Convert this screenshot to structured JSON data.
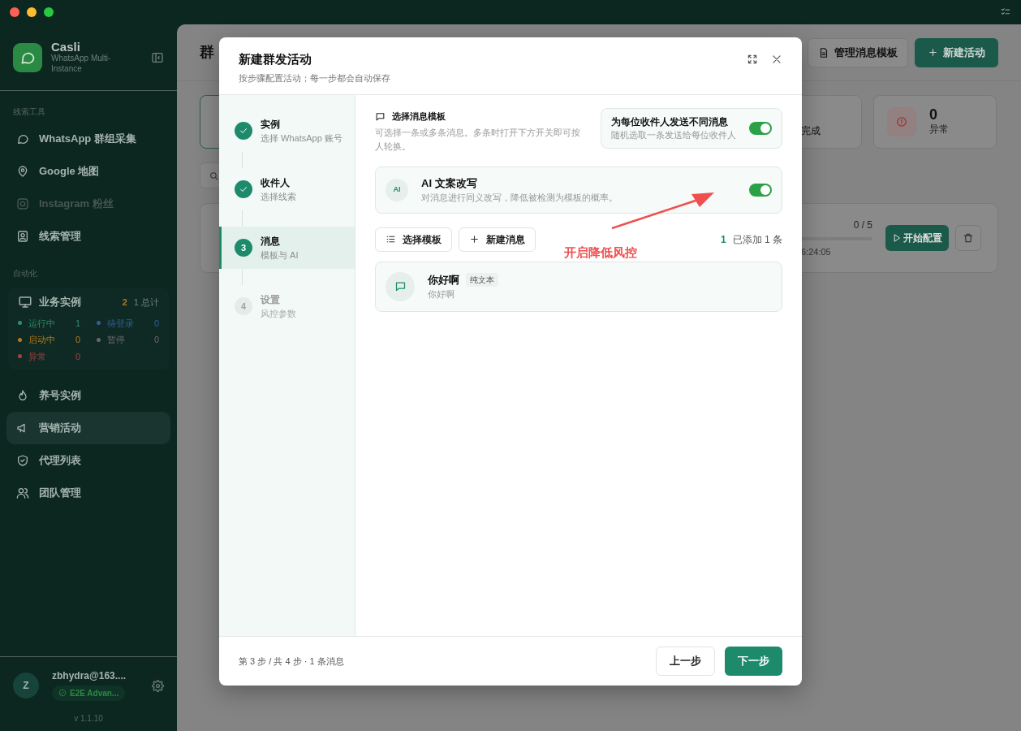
{
  "sidebar": {
    "app_name": "Casli",
    "app_subtitle": "WhatsApp Multi-Instance",
    "sections": [
      {
        "heading": "线索工具",
        "items": [
          {
            "label": "WhatsApp 群组采集",
            "disabled": false,
            "selected": false
          },
          {
            "label": "Google 地图",
            "disabled": false,
            "selected": false
          },
          {
            "label": "Instagram 粉丝",
            "disabled": true,
            "selected": false
          },
          {
            "label": "线索管理",
            "disabled": false,
            "selected": false
          }
        ]
      },
      {
        "heading": "自动化",
        "instances": {
          "title": "业务实例",
          "badge": "2",
          "total": "1 总计",
          "stats": [
            {
              "label": "运行中",
              "count": "1",
              "color": "#2f8f6a"
            },
            {
              "label": "待登录",
              "count": "0",
              "color": "#2f5f9a"
            },
            {
              "label": "启动中",
              "count": "0",
              "color": "#b57a1c"
            },
            {
              "label": "暂停",
              "count": "0",
              "color": "#6a6a6a"
            },
            {
              "label": "异常",
              "count": "0",
              "color": "#a34040"
            }
          ]
        },
        "items": [
          {
            "label": "养号实例",
            "disabled": false,
            "selected": false
          },
          {
            "label": "营销活动",
            "disabled": false,
            "selected": true
          },
          {
            "label": "代理列表",
            "disabled": false,
            "selected": false
          },
          {
            "label": "团队管理",
            "disabled": false,
            "selected": false
          }
        ]
      }
    ],
    "user": {
      "avatar": "Z",
      "email": "zbhydra@163....",
      "plan": "E2E Advan...",
      "version": "v 1.1.10"
    }
  },
  "main": {
    "title": "群",
    "buttons": [
      "管理消息模板",
      "新建活动"
    ],
    "stats": [
      {
        "label": "完成"
      },
      {
        "value": "0",
        "label": "异常"
      }
    ],
    "campaign": {
      "progress": "0 / 5",
      "level": 0,
      "time": "6:24:05",
      "start_button": "开始配置"
    }
  },
  "dialog": {
    "title": "新建群发活动",
    "subtitle": "按步骤配置活动；每一步都会自动保存",
    "steps": [
      {
        "kind": "done",
        "title": "实例",
        "subtitle": "选择 WhatsApp 账号",
        "selected": false
      },
      {
        "kind": "done",
        "title": "收件人",
        "subtitle": "选择线索",
        "selected": false
      },
      {
        "kind": "active",
        "number": "3",
        "title": "消息",
        "subtitle": "模板与 AI",
        "selected": true
      },
      {
        "kind": "pending",
        "number": "4",
        "title": "设置",
        "subtitle": "风控参数",
        "selected": false
      }
    ],
    "section_title": "选择消息模板",
    "section_desc": "可选择一条或多条消息。多条时打开下方开关即可按人轮换。",
    "vary_toggle": {
      "title": "为每位收件人发送不同消息",
      "desc": "随机选取一条发送给每位收件人",
      "on": true
    },
    "ai_toggle": {
      "badge": "AI",
      "title": "AI 文案改写",
      "desc": "对消息进行同义改写，降低被检测为模板的概率。",
      "on": true
    },
    "actions": [
      "选择模板",
      "新建消息"
    ],
    "added_count": "1",
    "added_text": "已添加 1 条",
    "messages": [
      {
        "title": "你好啊",
        "tag": "纯文本",
        "preview": "你好啊"
      }
    ],
    "annotation": "开启降低风控",
    "footer_text": "第 3 步 / 共 4 步 · 1 条消息",
    "back_button": "上一步",
    "next_button": "下一步"
  }
}
